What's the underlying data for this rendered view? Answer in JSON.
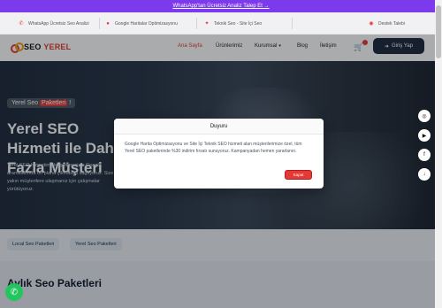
{
  "promo": {
    "text": "WhatsApp'tan Ücretsiz Analiz Talep Et →"
  },
  "info_bar": {
    "items": [
      {
        "icon": "whatsapp-icon",
        "label": "WhatsApp Ücretsiz Seo Analizi"
      },
      {
        "icon": "map-pin-icon",
        "label": "Google Haritalar Optimizasyonu"
      },
      {
        "icon": "wrench-icon",
        "label": "Teknik Seo - Site İçi Seo"
      },
      {
        "icon": "headset-icon",
        "label": "Destek Talebi"
      }
    ]
  },
  "nav": {
    "logo_prefix": "SEO ",
    "logo_accent": "YEREL",
    "links": [
      "Ana Sayfa",
      "Ürünlerimiz",
      "Kurumsal",
      "Blog",
      "İletişim"
    ],
    "login": "Giriş Yap"
  },
  "hero": {
    "badge_prefix": "Yerel Seo ",
    "badge_accent": "Paketleri",
    "badge_suffix": " !",
    "title": "Yerel SEO Hizmeti ile Daha Fazla Müşteri",
    "description": "Yerel SEO hizmetimizle işletmenizin Google aramalarında ön plana çıkmasını sağlıyoruz. Size yakın müşterilere ulaşmanız için çalışmalar yürütüyoruz."
  },
  "tabs": [
    "Local Seo Paketleri",
    "Yerel Seo Paketleri"
  ],
  "section": {
    "title": "Aylık Seo Paketleri"
  },
  "modal": {
    "title": "Duyuru",
    "body": "Google Harita Optimizasyonu ve Site İçi Teknik SEO hizmeti alan müşterilerimize özel, tüm Yerel SEO paketlerinde %30 indirim fırsatı sunuyoruz. Kampanyadan hemen yararlanın.",
    "close": "Kapat"
  },
  "colors": {
    "accent": "#e53935",
    "promo": "#7c3aed",
    "dark": "#1e293b",
    "whatsapp": "#22c55e"
  }
}
